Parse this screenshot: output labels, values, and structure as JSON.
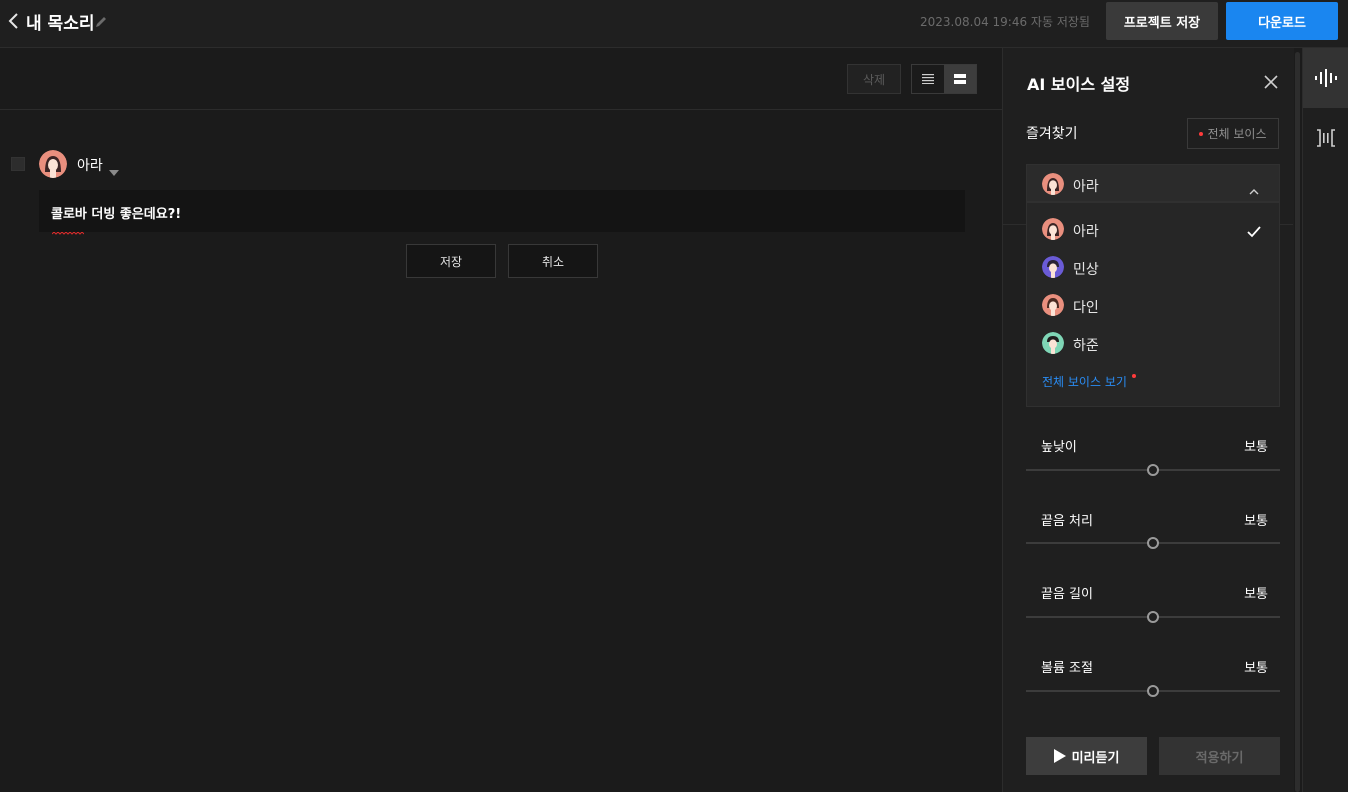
{
  "header": {
    "title": "내 목소리",
    "autosave": "2023.08.04 19:46 자동 저장됨",
    "save_project_label": "프로젝트 저장",
    "download_label": "다운로드"
  },
  "toolbar": {
    "delete_label": "삭제"
  },
  "editor": {
    "speaker_name": "아라",
    "text": "콜로바 더빙 좋은데요?!",
    "save_label": "저장",
    "cancel_label": "취소"
  },
  "panel": {
    "title": "AI 보이스 설정",
    "favorites_label": "즐겨찾기",
    "all_voices_label": "전체 보이스",
    "selected_voice": "아라",
    "voices": [
      {
        "name": "아라",
        "selected": true
      },
      {
        "name": "민상",
        "selected": false
      },
      {
        "name": "다인",
        "selected": false
      },
      {
        "name": "하준",
        "selected": false
      }
    ],
    "view_all_label": "전체 보이스 보기",
    "params": [
      {
        "label": "높낮이",
        "value": "보통",
        "level": 0.5
      },
      {
        "label": "끝음 처리",
        "value": "보통",
        "level": 0.5
      },
      {
        "label": "끝음 길이",
        "value": "보통",
        "level": 0.5
      },
      {
        "label": "볼륨 조절",
        "value": "보통",
        "level": 0.5
      }
    ],
    "preview_label": "미리듣기",
    "apply_label": "적용하기"
  },
  "colors": {
    "accent": "#1a86f0",
    "link": "#2a8cf3",
    "dot": "#ff3b3b"
  }
}
